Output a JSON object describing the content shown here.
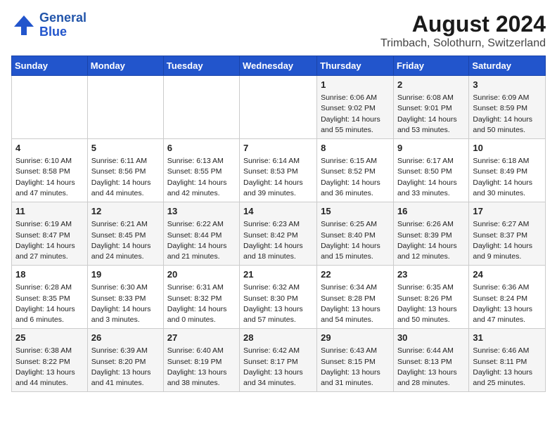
{
  "header": {
    "logo_line1": "General",
    "logo_line2": "Blue",
    "title": "August 2024",
    "subtitle": "Trimbach, Solothurn, Switzerland"
  },
  "days_of_week": [
    "Sunday",
    "Monday",
    "Tuesday",
    "Wednesday",
    "Thursday",
    "Friday",
    "Saturday"
  ],
  "weeks": [
    [
      {
        "day": "",
        "info": ""
      },
      {
        "day": "",
        "info": ""
      },
      {
        "day": "",
        "info": ""
      },
      {
        "day": "",
        "info": ""
      },
      {
        "day": "1",
        "info": "Sunrise: 6:06 AM\nSunset: 9:02 PM\nDaylight: 14 hours\nand 55 minutes."
      },
      {
        "day": "2",
        "info": "Sunrise: 6:08 AM\nSunset: 9:01 PM\nDaylight: 14 hours\nand 53 minutes."
      },
      {
        "day": "3",
        "info": "Sunrise: 6:09 AM\nSunset: 8:59 PM\nDaylight: 14 hours\nand 50 minutes."
      }
    ],
    [
      {
        "day": "4",
        "info": "Sunrise: 6:10 AM\nSunset: 8:58 PM\nDaylight: 14 hours\nand 47 minutes."
      },
      {
        "day": "5",
        "info": "Sunrise: 6:11 AM\nSunset: 8:56 PM\nDaylight: 14 hours\nand 44 minutes."
      },
      {
        "day": "6",
        "info": "Sunrise: 6:13 AM\nSunset: 8:55 PM\nDaylight: 14 hours\nand 42 minutes."
      },
      {
        "day": "7",
        "info": "Sunrise: 6:14 AM\nSunset: 8:53 PM\nDaylight: 14 hours\nand 39 minutes."
      },
      {
        "day": "8",
        "info": "Sunrise: 6:15 AM\nSunset: 8:52 PM\nDaylight: 14 hours\nand 36 minutes."
      },
      {
        "day": "9",
        "info": "Sunrise: 6:17 AM\nSunset: 8:50 PM\nDaylight: 14 hours\nand 33 minutes."
      },
      {
        "day": "10",
        "info": "Sunrise: 6:18 AM\nSunset: 8:49 PM\nDaylight: 14 hours\nand 30 minutes."
      }
    ],
    [
      {
        "day": "11",
        "info": "Sunrise: 6:19 AM\nSunset: 8:47 PM\nDaylight: 14 hours\nand 27 minutes."
      },
      {
        "day": "12",
        "info": "Sunrise: 6:21 AM\nSunset: 8:45 PM\nDaylight: 14 hours\nand 24 minutes."
      },
      {
        "day": "13",
        "info": "Sunrise: 6:22 AM\nSunset: 8:44 PM\nDaylight: 14 hours\nand 21 minutes."
      },
      {
        "day": "14",
        "info": "Sunrise: 6:23 AM\nSunset: 8:42 PM\nDaylight: 14 hours\nand 18 minutes."
      },
      {
        "day": "15",
        "info": "Sunrise: 6:25 AM\nSunset: 8:40 PM\nDaylight: 14 hours\nand 15 minutes."
      },
      {
        "day": "16",
        "info": "Sunrise: 6:26 AM\nSunset: 8:39 PM\nDaylight: 14 hours\nand 12 minutes."
      },
      {
        "day": "17",
        "info": "Sunrise: 6:27 AM\nSunset: 8:37 PM\nDaylight: 14 hours\nand 9 minutes."
      }
    ],
    [
      {
        "day": "18",
        "info": "Sunrise: 6:28 AM\nSunset: 8:35 PM\nDaylight: 14 hours\nand 6 minutes."
      },
      {
        "day": "19",
        "info": "Sunrise: 6:30 AM\nSunset: 8:33 PM\nDaylight: 14 hours\nand 3 minutes."
      },
      {
        "day": "20",
        "info": "Sunrise: 6:31 AM\nSunset: 8:32 PM\nDaylight: 14 hours\nand 0 minutes."
      },
      {
        "day": "21",
        "info": "Sunrise: 6:32 AM\nSunset: 8:30 PM\nDaylight: 13 hours\nand 57 minutes."
      },
      {
        "day": "22",
        "info": "Sunrise: 6:34 AM\nSunset: 8:28 PM\nDaylight: 13 hours\nand 54 minutes."
      },
      {
        "day": "23",
        "info": "Sunrise: 6:35 AM\nSunset: 8:26 PM\nDaylight: 13 hours\nand 50 minutes."
      },
      {
        "day": "24",
        "info": "Sunrise: 6:36 AM\nSunset: 8:24 PM\nDaylight: 13 hours\nand 47 minutes."
      }
    ],
    [
      {
        "day": "25",
        "info": "Sunrise: 6:38 AM\nSunset: 8:22 PM\nDaylight: 13 hours\nand 44 minutes."
      },
      {
        "day": "26",
        "info": "Sunrise: 6:39 AM\nSunset: 8:20 PM\nDaylight: 13 hours\nand 41 minutes."
      },
      {
        "day": "27",
        "info": "Sunrise: 6:40 AM\nSunset: 8:19 PM\nDaylight: 13 hours\nand 38 minutes."
      },
      {
        "day": "28",
        "info": "Sunrise: 6:42 AM\nSunset: 8:17 PM\nDaylight: 13 hours\nand 34 minutes."
      },
      {
        "day": "29",
        "info": "Sunrise: 6:43 AM\nSunset: 8:15 PM\nDaylight: 13 hours\nand 31 minutes."
      },
      {
        "day": "30",
        "info": "Sunrise: 6:44 AM\nSunset: 8:13 PM\nDaylight: 13 hours\nand 28 minutes."
      },
      {
        "day": "31",
        "info": "Sunrise: 6:46 AM\nSunset: 8:11 PM\nDaylight: 13 hours\nand 25 minutes."
      }
    ]
  ]
}
